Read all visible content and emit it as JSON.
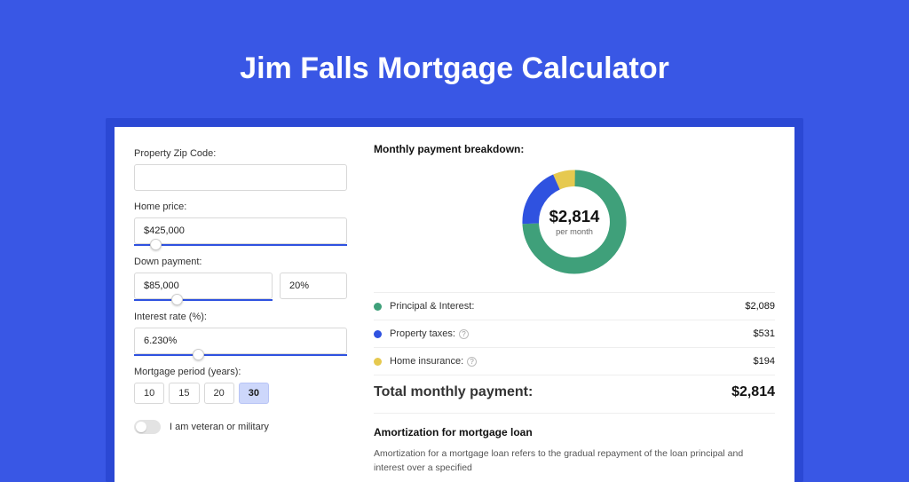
{
  "page_title": "Jim Falls Mortgage Calculator",
  "form": {
    "zip_label": "Property Zip Code:",
    "zip_value": "",
    "home_price_label": "Home price:",
    "home_price_value": "$425,000",
    "down_payment_label": "Down payment:",
    "down_payment_value": "$85,000",
    "down_payment_pct": "20%",
    "interest_label": "Interest rate (%):",
    "interest_value": "6.230%",
    "period_label": "Mortgage period (years):",
    "periods": [
      "10",
      "15",
      "20",
      "30"
    ],
    "period_selected_index": 3,
    "veteran_label": "I am veteran or military"
  },
  "breakdown": {
    "title": "Monthly payment breakdown:",
    "center_value": "$2,814",
    "center_sub": "per month",
    "items": [
      {
        "label": "Principal & Interest:",
        "value": "$2,089",
        "color": "green",
        "info": false
      },
      {
        "label": "Property taxes:",
        "value": "$531",
        "color": "blue",
        "info": true
      },
      {
        "label": "Home insurance:",
        "value": "$194",
        "color": "yellow",
        "info": true
      }
    ],
    "total_label": "Total monthly payment:",
    "total_value": "$2,814"
  },
  "chart_data": {
    "type": "pie",
    "title": "Monthly payment breakdown",
    "series": [
      {
        "name": "Principal & Interest",
        "value": 2089,
        "color": "#3fa07a"
      },
      {
        "name": "Property taxes",
        "value": 531,
        "color": "#2f52e0"
      },
      {
        "name": "Home insurance",
        "value": 194,
        "color": "#e6c94f"
      }
    ],
    "total": 2814
  },
  "amortization": {
    "title": "Amortization for mortgage loan",
    "text": "Amortization for a mortgage loan refers to the gradual repayment of the loan principal and interest over a specified"
  }
}
